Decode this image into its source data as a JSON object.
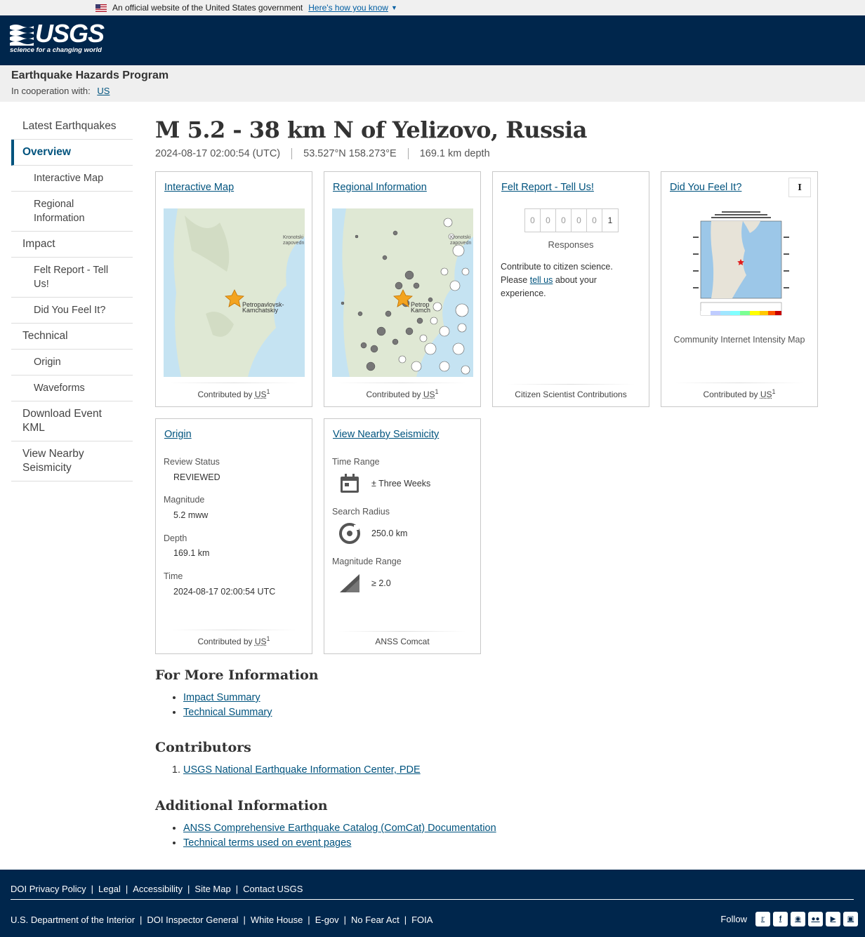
{
  "gov_banner": {
    "text": "An official website of the United States government",
    "link": "Here's how you know"
  },
  "header": {
    "logo_text": "USGS",
    "logo_tagline": "science for a changing world"
  },
  "program": {
    "title": "Earthquake Hazards Program",
    "coop_label": "In cooperation with:",
    "coop_link": "US"
  },
  "sidebar": {
    "items": [
      {
        "label": "Latest Earthquakes"
      },
      {
        "label": "Overview"
      },
      {
        "label": "Interactive Map"
      },
      {
        "label": "Regional Information"
      },
      {
        "label": "Impact"
      },
      {
        "label": "Felt Report - Tell Us!"
      },
      {
        "label": "Did You Feel It?"
      },
      {
        "label": "Technical"
      },
      {
        "label": "Origin"
      },
      {
        "label": "Waveforms"
      },
      {
        "label": "Download Event KML"
      },
      {
        "label": "View Nearby Seismicity"
      }
    ]
  },
  "event": {
    "title": "M 5.2 - 38 km N of Yelizovo, Russia",
    "time": "2024-08-17 02:00:54 (UTC)",
    "location": "53.527°N 158.273°E",
    "depth": "169.1 km depth"
  },
  "cards": {
    "interactive_map": {
      "title": "Interactive Map",
      "contrib_prefix": "Contributed by",
      "contrib_abbr": "US",
      "contrib_sup": "1",
      "map_label_1": "Petropavlovsk-",
      "map_label_2": "Kamchatskiy",
      "map_label_3": "Kronotski",
      "map_label_4": "zapovedn"
    },
    "regional_info": {
      "title": "Regional Information",
      "contrib_prefix": "Contributed by",
      "contrib_abbr": "US",
      "contrib_sup": "1",
      "map_label_1": "Petrop",
      "map_label_2": "Kamch",
      "map_label_3": "Kronotski",
      "map_label_4": "zapovedn"
    },
    "felt_report": {
      "title": "Felt Report - Tell Us!",
      "digits": [
        "0",
        "0",
        "0",
        "0",
        "0",
        "1"
      ],
      "responses_label": "Responses",
      "text_1": "Contribute to citizen science. Please",
      "link": "tell us",
      "text_2": "about your experience.",
      "footer": "Citizen Scientist Contributions"
    },
    "dyfi": {
      "title": "Did You Feel It?",
      "info_label": "I",
      "caption": "Community Internet Intensity Map",
      "contrib_prefix": "Contributed by",
      "contrib_abbr": "US",
      "contrib_sup": "1"
    },
    "origin": {
      "title": "Origin",
      "review_label": "Review Status",
      "review_value": "REVIEWED",
      "mag_label": "Magnitude",
      "mag_value": "5.2 mww",
      "depth_label": "Depth",
      "depth_value": "169.1 km",
      "time_label": "Time",
      "time_value": "2024-08-17 02:00:54 UTC",
      "contrib_prefix": "Contributed by",
      "contrib_abbr": "US",
      "contrib_sup": "1"
    },
    "nearby": {
      "title": "View Nearby Seismicity",
      "time_label": "Time Range",
      "time_value": "± Three Weeks",
      "radius_label": "Search Radius",
      "radius_value": "250.0 km",
      "mag_label": "Magnitude Range",
      "mag_value": "≥ 2.0",
      "footer": "ANSS Comcat"
    }
  },
  "more_info": {
    "heading": "For More Information",
    "links": [
      "Impact Summary",
      "Technical Summary"
    ]
  },
  "contributors": {
    "heading": "Contributors",
    "links": [
      "USGS National Earthquake Information Center, PDE"
    ]
  },
  "additional": {
    "heading": "Additional Information",
    "links": [
      "ANSS Comprehensive Earthquake Catalog (ComCat) Documentation",
      "Technical terms used on event pages"
    ]
  },
  "footer": {
    "row1": [
      "DOI Privacy Policy",
      "Legal",
      "Accessibility",
      "Site Map",
      "Contact USGS"
    ],
    "row2": [
      "U.S. Department of the Interior",
      "DOI Inspector General",
      "White House",
      "E-gov",
      "No Fear Act",
      "FOIA"
    ],
    "follow_label": "Follow",
    "social_icons": [
      "twitter-icon",
      "facebook-icon",
      "github-icon",
      "flickr-icon",
      "youtube-icon",
      "instagram-icon"
    ]
  }
}
